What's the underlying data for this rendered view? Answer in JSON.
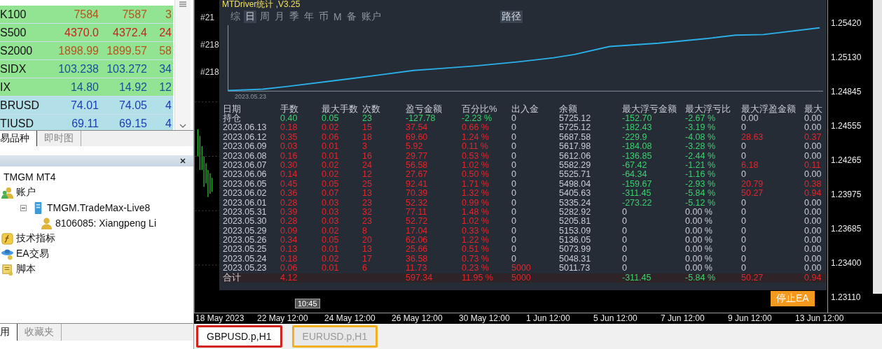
{
  "market_watch": {
    "rows": [
      {
        "symbol": "K100",
        "bid": "7584",
        "ask": "7587",
        "spread": "3",
        "color": "#b5541c",
        "kind": "index"
      },
      {
        "symbol": "S500",
        "bid": "4370.0",
        "ask": "4372.4",
        "spread": "24",
        "color": "#c8231e",
        "kind": "index"
      },
      {
        "symbol": "S2000",
        "bid": "1898.99",
        "ask": "1899.57",
        "spread": "58",
        "color": "#b5541c",
        "kind": "index"
      },
      {
        "symbol": "SIDX",
        "bid": "103.238",
        "ask": "103.272",
        "spread": "34",
        "color": "#1a4f9c",
        "kind": "index"
      },
      {
        "symbol": "IX",
        "bid": "14.80",
        "ask": "14.92",
        "spread": "12",
        "color": "#1a4f9c",
        "kind": "index"
      },
      {
        "symbol": "BRUSD",
        "bid": "74.01",
        "ask": "74.05",
        "spread": "4",
        "color": "#1a3fb0",
        "kind": "commodity"
      },
      {
        "symbol": "TIUSD",
        "bid": "69.11",
        "ask": "69.15",
        "spread": "4",
        "color": "#1a3fb0",
        "kind": "commodity"
      }
    ],
    "tabs": [
      {
        "label": "易品种",
        "selected": true
      },
      {
        "label": "即时图",
        "selected": false
      }
    ]
  },
  "navigator": {
    "tree": [
      {
        "label": "TMGM MT4",
        "children": [
          {
            "label": "账户",
            "kind": "accounts",
            "children": [
              {
                "label": "TMGM.TradeMax-Live8",
                "kind": "server",
                "expanded": true,
                "children": [
                  {
                    "label": "8106085: Xiangpeng Li",
                    "kind": "account"
                  }
                ]
              }
            ]
          },
          {
            "label": "技术指标",
            "kind": "indicators"
          },
          {
            "label": "EA交易",
            "kind": "experts"
          },
          {
            "label": "脚本",
            "kind": "scripts"
          }
        ]
      }
    ],
    "tabs": [
      {
        "label": "用",
        "selected": true
      },
      {
        "label": "收藏夹",
        "selected": false
      }
    ]
  },
  "chart": {
    "side_labels": [
      "#21",
      "#218",
      "#218"
    ],
    "price_axis": [
      "1.25420",
      "1.25130",
      "1.24845",
      "1.24555",
      "1.24265",
      "1.23975",
      "1.23685",
      "1.23400",
      "1.23110"
    ],
    "time_axis": [
      "18 May 2023",
      "22 May 12:00",
      "24 May 12:00",
      "26 May 12:00",
      "30 May 12:00",
      "1 Jun 12:00",
      "5 Jun 12:00",
      "7 Jun 12:00",
      "9 Jun 12:00",
      "13 Jun 12:00"
    ],
    "time_marker": "10:45",
    "stop_button": "停止EA",
    "tabs": [
      {
        "label": "GBPUSD.p,H1",
        "selected": true,
        "color": "#d2231c"
      },
      {
        "label": "EURUSD.p,H1",
        "selected": false,
        "color": "#f0b020"
      }
    ]
  },
  "stats_panel": {
    "title": "MTDriver统计 ,V3.25",
    "menu": [
      {
        "label": "综",
        "selected": false
      },
      {
        "label": "日",
        "selected": true
      },
      {
        "label": "周",
        "selected": false
      },
      {
        "label": "月",
        "selected": false
      },
      {
        "label": "季",
        "selected": false
      },
      {
        "label": "年",
        "selected": false
      },
      {
        "label": "币",
        "selected": false
      },
      {
        "label": "M",
        "selected": false
      },
      {
        "label": "备",
        "selected": false
      },
      {
        "label": "账户",
        "selected": false
      }
    ],
    "path_button": "路径",
    "equity_start_date": "2023.05.23",
    "columns": [
      "日期",
      "手数",
      "最大手数",
      "次数",
      "盈亏金额",
      "百分比%",
      "出入金",
      "余额",
      "最大浮亏金额",
      "最大浮亏比",
      "最大浮盈金额",
      "最大"
    ],
    "rows": [
      {
        "kind": "open",
        "cells": [
          {
            "text": "持仓",
            "color": "#c9ced6"
          },
          {
            "text": "0.40",
            "color": "#3bd16f"
          },
          {
            "text": "0.05",
            "color": "#3bd16f"
          },
          {
            "text": "23",
            "color": "#3bd16f"
          },
          {
            "text": "-127.78",
            "color": "#3bd16f"
          },
          {
            "text": "-2.23 %",
            "color": "#3bd16f"
          },
          {
            "text": "0",
            "color": "#c9ced6"
          },
          {
            "text": "5725.12",
            "color": "#c9ced6"
          },
          {
            "text": "-152.70",
            "color": "#3bd16f"
          },
          {
            "text": "-2.67 %",
            "color": "#3bd16f"
          },
          {
            "text": "0.00",
            "color": "#c9ced6"
          },
          {
            "text": "0.00",
            "color": "#c9ced6"
          }
        ]
      },
      {
        "kind": "day",
        "cells": [
          {
            "text": "2023.06.13",
            "color": "#c9ced6"
          },
          {
            "text": "0.18",
            "color": "#e3262e"
          },
          {
            "text": "0.02",
            "color": "#e3262e"
          },
          {
            "text": "15",
            "color": "#e3262e"
          },
          {
            "text": "37.54",
            "color": "#e3262e"
          },
          {
            "text": "0.66 %",
            "color": "#e3262e"
          },
          {
            "text": "0",
            "color": "#c9ced6"
          },
          {
            "text": "5725.12",
            "color": "#c9ced6"
          },
          {
            "text": "-182.43",
            "color": "#3bd16f"
          },
          {
            "text": "-3.19 %",
            "color": "#3bd16f"
          },
          {
            "text": "0",
            "color": "#c9ced6"
          },
          {
            "text": "0.00",
            "color": "#c9ced6"
          }
        ]
      },
      {
        "kind": "day",
        "cells": [
          {
            "text": "2023.06.12",
            "color": "#c9ced6"
          },
          {
            "text": "0.35",
            "color": "#e3262e"
          },
          {
            "text": "0.06",
            "color": "#e3262e"
          },
          {
            "text": "18",
            "color": "#e3262e"
          },
          {
            "text": "69.60",
            "color": "#e3262e"
          },
          {
            "text": "1.24 %",
            "color": "#e3262e"
          },
          {
            "text": "0",
            "color": "#c9ced6"
          },
          {
            "text": "5687.58",
            "color": "#c9ced6"
          },
          {
            "text": "-229.9",
            "color": "#3bd16f"
          },
          {
            "text": "-4.08 %",
            "color": "#3bd16f"
          },
          {
            "text": "28.63",
            "color": "#e3262e"
          },
          {
            "text": "0.37",
            "color": "#e3262e"
          }
        ]
      },
      {
        "kind": "day",
        "cells": [
          {
            "text": "2023.06.09",
            "color": "#c9ced6"
          },
          {
            "text": "0.03",
            "color": "#e3262e"
          },
          {
            "text": "0.01",
            "color": "#e3262e"
          },
          {
            "text": "3",
            "color": "#e3262e"
          },
          {
            "text": "5.92",
            "color": "#e3262e"
          },
          {
            "text": "0.11 %",
            "color": "#e3262e"
          },
          {
            "text": "0",
            "color": "#c9ced6"
          },
          {
            "text": "5617.98",
            "color": "#c9ced6"
          },
          {
            "text": "-184.08",
            "color": "#3bd16f"
          },
          {
            "text": "-3.28 %",
            "color": "#3bd16f"
          },
          {
            "text": "0",
            "color": "#c9ced6"
          },
          {
            "text": "0.00",
            "color": "#c9ced6"
          }
        ]
      },
      {
        "kind": "day",
        "cells": [
          {
            "text": "2023.06.08",
            "color": "#c9ced6"
          },
          {
            "text": "0.16",
            "color": "#e3262e"
          },
          {
            "text": "0.01",
            "color": "#e3262e"
          },
          {
            "text": "16",
            "color": "#e3262e"
          },
          {
            "text": "29.77",
            "color": "#e3262e"
          },
          {
            "text": "0.53 %",
            "color": "#e3262e"
          },
          {
            "text": "0",
            "color": "#c9ced6"
          },
          {
            "text": "5612.06",
            "color": "#c9ced6"
          },
          {
            "text": "-136.85",
            "color": "#3bd16f"
          },
          {
            "text": "-2.44 %",
            "color": "#3bd16f"
          },
          {
            "text": "0",
            "color": "#c9ced6"
          },
          {
            "text": "0.00",
            "color": "#c9ced6"
          }
        ]
      },
      {
        "kind": "day",
        "cells": [
          {
            "text": "2023.06.07",
            "color": "#c9ced6"
          },
          {
            "text": "0.30",
            "color": "#e3262e"
          },
          {
            "text": "0.02",
            "color": "#e3262e"
          },
          {
            "text": "24",
            "color": "#e3262e"
          },
          {
            "text": "56.58",
            "color": "#e3262e"
          },
          {
            "text": "1.02 %",
            "color": "#e3262e"
          },
          {
            "text": "0",
            "color": "#c9ced6"
          },
          {
            "text": "5582.29",
            "color": "#c9ced6"
          },
          {
            "text": "-67.42",
            "color": "#3bd16f"
          },
          {
            "text": "-1.21 %",
            "color": "#3bd16f"
          },
          {
            "text": "6.18",
            "color": "#e3262e"
          },
          {
            "text": "0.11",
            "color": "#e3262e"
          }
        ]
      },
      {
        "kind": "day",
        "cells": [
          {
            "text": "2023.06.06",
            "color": "#c9ced6"
          },
          {
            "text": "0.14",
            "color": "#e3262e"
          },
          {
            "text": "0.02",
            "color": "#e3262e"
          },
          {
            "text": "12",
            "color": "#e3262e"
          },
          {
            "text": "27.67",
            "color": "#e3262e"
          },
          {
            "text": "0.50 %",
            "color": "#e3262e"
          },
          {
            "text": "0",
            "color": "#c9ced6"
          },
          {
            "text": "5525.71",
            "color": "#c9ced6"
          },
          {
            "text": "-64.34",
            "color": "#3bd16f"
          },
          {
            "text": "-1.16 %",
            "color": "#3bd16f"
          },
          {
            "text": "0",
            "color": "#c9ced6"
          },
          {
            "text": "0.00",
            "color": "#c9ced6"
          }
        ]
      },
      {
        "kind": "day",
        "cells": [
          {
            "text": "2023.06.05",
            "color": "#c9ced6"
          },
          {
            "text": "0.45",
            "color": "#e3262e"
          },
          {
            "text": "0.05",
            "color": "#e3262e"
          },
          {
            "text": "25",
            "color": "#e3262e"
          },
          {
            "text": "92.41",
            "color": "#e3262e"
          },
          {
            "text": "1.71 %",
            "color": "#e3262e"
          },
          {
            "text": "0",
            "color": "#c9ced6"
          },
          {
            "text": "5498.04",
            "color": "#c9ced6"
          },
          {
            "text": "-159.67",
            "color": "#3bd16f"
          },
          {
            "text": "-2.93 %",
            "color": "#3bd16f"
          },
          {
            "text": "20.79",
            "color": "#e3262e"
          },
          {
            "text": "0.38",
            "color": "#e3262e"
          }
        ]
      },
      {
        "kind": "day",
        "cells": [
          {
            "text": "2023.06.02",
            "color": "#c9ced6"
          },
          {
            "text": "0.36",
            "color": "#e3262e"
          },
          {
            "text": "0.07",
            "color": "#e3262e"
          },
          {
            "text": "13",
            "color": "#e3262e"
          },
          {
            "text": "70.39",
            "color": "#e3262e"
          },
          {
            "text": "1.32 %",
            "color": "#e3262e"
          },
          {
            "text": "0",
            "color": "#c9ced6"
          },
          {
            "text": "5405.63",
            "color": "#c9ced6"
          },
          {
            "text": "-311.45",
            "color": "#3bd16f"
          },
          {
            "text": "-5.84 %",
            "color": "#3bd16f"
          },
          {
            "text": "50.27",
            "color": "#e3262e"
          },
          {
            "text": "0.94",
            "color": "#e3262e"
          }
        ]
      },
      {
        "kind": "day",
        "cells": [
          {
            "text": "2023.06.01",
            "color": "#c9ced6"
          },
          {
            "text": "0.28",
            "color": "#e3262e"
          },
          {
            "text": "0.03",
            "color": "#e3262e"
          },
          {
            "text": "23",
            "color": "#e3262e"
          },
          {
            "text": "52.32",
            "color": "#e3262e"
          },
          {
            "text": "0.99 %",
            "color": "#e3262e"
          },
          {
            "text": "0",
            "color": "#c9ced6"
          },
          {
            "text": "5335.24",
            "color": "#c9ced6"
          },
          {
            "text": "-273.22",
            "color": "#3bd16f"
          },
          {
            "text": "-5.12 %",
            "color": "#3bd16f"
          },
          {
            "text": "0",
            "color": "#c9ced6"
          },
          {
            "text": "0.00",
            "color": "#c9ced6"
          }
        ]
      },
      {
        "kind": "day",
        "cells": [
          {
            "text": "2023.05.31",
            "color": "#c9ced6"
          },
          {
            "text": "0.39",
            "color": "#e3262e"
          },
          {
            "text": "0.03",
            "color": "#e3262e"
          },
          {
            "text": "32",
            "color": "#e3262e"
          },
          {
            "text": "77.11",
            "color": "#e3262e"
          },
          {
            "text": "1.48 %",
            "color": "#e3262e"
          },
          {
            "text": "0",
            "color": "#c9ced6"
          },
          {
            "text": "5282.92",
            "color": "#c9ced6"
          },
          {
            "text": "0",
            "color": "#c9ced6"
          },
          {
            "text": "0.00 %",
            "color": "#c9ced6"
          },
          {
            "text": "0",
            "color": "#c9ced6"
          },
          {
            "text": "0.00",
            "color": "#c9ced6"
          }
        ]
      },
      {
        "kind": "day",
        "cells": [
          {
            "text": "2023.05.30",
            "color": "#c9ced6"
          },
          {
            "text": "0.28",
            "color": "#e3262e"
          },
          {
            "text": "0.03",
            "color": "#e3262e"
          },
          {
            "text": "23",
            "color": "#e3262e"
          },
          {
            "text": "52.72",
            "color": "#e3262e"
          },
          {
            "text": "1.02 %",
            "color": "#e3262e"
          },
          {
            "text": "0",
            "color": "#c9ced6"
          },
          {
            "text": "5205.81",
            "color": "#c9ced6"
          },
          {
            "text": "0",
            "color": "#c9ced6"
          },
          {
            "text": "0.00 %",
            "color": "#c9ced6"
          },
          {
            "text": "0",
            "color": "#c9ced6"
          },
          {
            "text": "0.00",
            "color": "#c9ced6"
          }
        ]
      },
      {
        "kind": "day",
        "cells": [
          {
            "text": "2023.05.29",
            "color": "#c9ced6"
          },
          {
            "text": "0.09",
            "color": "#e3262e"
          },
          {
            "text": "0.02",
            "color": "#e3262e"
          },
          {
            "text": "8",
            "color": "#e3262e"
          },
          {
            "text": "17.04",
            "color": "#e3262e"
          },
          {
            "text": "0.33 %",
            "color": "#e3262e"
          },
          {
            "text": "0",
            "color": "#c9ced6"
          },
          {
            "text": "5153.09",
            "color": "#c9ced6"
          },
          {
            "text": "0",
            "color": "#c9ced6"
          },
          {
            "text": "0.00 %",
            "color": "#c9ced6"
          },
          {
            "text": "0",
            "color": "#c9ced6"
          },
          {
            "text": "0.00",
            "color": "#c9ced6"
          }
        ]
      },
      {
        "kind": "day",
        "cells": [
          {
            "text": "2023.05.26",
            "color": "#c9ced6"
          },
          {
            "text": "0.34",
            "color": "#e3262e"
          },
          {
            "text": "0.05",
            "color": "#e3262e"
          },
          {
            "text": "20",
            "color": "#e3262e"
          },
          {
            "text": "62.06",
            "color": "#e3262e"
          },
          {
            "text": "1.22 %",
            "color": "#e3262e"
          },
          {
            "text": "0",
            "color": "#c9ced6"
          },
          {
            "text": "5136.05",
            "color": "#c9ced6"
          },
          {
            "text": "0",
            "color": "#c9ced6"
          },
          {
            "text": "0.00 %",
            "color": "#c9ced6"
          },
          {
            "text": "0",
            "color": "#c9ced6"
          },
          {
            "text": "0.00",
            "color": "#c9ced6"
          }
        ]
      },
      {
        "kind": "day",
        "cells": [
          {
            "text": "2023.05.25",
            "color": "#c9ced6"
          },
          {
            "text": "0.13",
            "color": "#e3262e"
          },
          {
            "text": "0.01",
            "color": "#e3262e"
          },
          {
            "text": "13",
            "color": "#e3262e"
          },
          {
            "text": "25.66",
            "color": "#e3262e"
          },
          {
            "text": "0.51 %",
            "color": "#e3262e"
          },
          {
            "text": "0",
            "color": "#c9ced6"
          },
          {
            "text": "5073.99",
            "color": "#c9ced6"
          },
          {
            "text": "0",
            "color": "#c9ced6"
          },
          {
            "text": "0.00 %",
            "color": "#c9ced6"
          },
          {
            "text": "0",
            "color": "#c9ced6"
          },
          {
            "text": "0.00",
            "color": "#c9ced6"
          }
        ]
      },
      {
        "kind": "day",
        "cells": [
          {
            "text": "2023.05.24",
            "color": "#c9ced6"
          },
          {
            "text": "0.18",
            "color": "#e3262e"
          },
          {
            "text": "0.02",
            "color": "#e3262e"
          },
          {
            "text": "17",
            "color": "#e3262e"
          },
          {
            "text": "36.58",
            "color": "#e3262e"
          },
          {
            "text": "0.73 %",
            "color": "#e3262e"
          },
          {
            "text": "0",
            "color": "#c9ced6"
          },
          {
            "text": "5048.31",
            "color": "#c9ced6"
          },
          {
            "text": "0",
            "color": "#c9ced6"
          },
          {
            "text": "0.00 %",
            "color": "#c9ced6"
          },
          {
            "text": "0",
            "color": "#c9ced6"
          },
          {
            "text": "0.00",
            "color": "#c9ced6"
          }
        ]
      },
      {
        "kind": "day",
        "cells": [
          {
            "text": "2023.05.23",
            "color": "#c9ced6"
          },
          {
            "text": "0.06",
            "color": "#e3262e"
          },
          {
            "text": "0.01",
            "color": "#e3262e"
          },
          {
            "text": "6",
            "color": "#e3262e"
          },
          {
            "text": "11.73",
            "color": "#e3262e"
          },
          {
            "text": "0.23 %",
            "color": "#e3262e"
          },
          {
            "text": "5000",
            "color": "#e3262e"
          },
          {
            "text": "5011.73",
            "color": "#c9ced6"
          },
          {
            "text": "0",
            "color": "#c9ced6"
          },
          {
            "text": "0.00 %",
            "color": "#c9ced6"
          },
          {
            "text": "0",
            "color": "#c9ced6"
          },
          {
            "text": "0.00",
            "color": "#c9ced6"
          }
        ]
      },
      {
        "kind": "total",
        "cells": [
          {
            "text": "合计",
            "color": "#c9ced6"
          },
          {
            "text": "4.12",
            "color": "#e3262e"
          },
          null,
          null,
          {
            "text": "597.34",
            "color": "#e3262e"
          },
          {
            "text": "11.95 %",
            "color": "#e3262e"
          },
          {
            "text": "5000",
            "color": "#e3262e"
          },
          null,
          {
            "text": "-311.45",
            "color": "#3bd16f"
          },
          {
            "text": "-5.84 %",
            "color": "#3bd16f"
          },
          {
            "text": "50.27",
            "color": "#e3262e"
          },
          {
            "text": "0.94",
            "color": "#e3262e"
          }
        ]
      }
    ]
  }
}
